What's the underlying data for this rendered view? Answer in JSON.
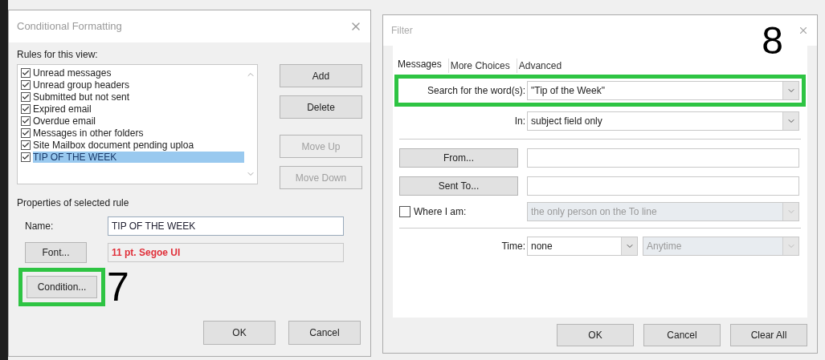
{
  "conditional_formatting": {
    "title": "Conditional Formatting",
    "rules_label": "Rules for this view:",
    "rules": [
      {
        "label": "Unread messages",
        "checked": true,
        "selected": false
      },
      {
        "label": "Unread group headers",
        "checked": true,
        "selected": false
      },
      {
        "label": "Submitted but not sent",
        "checked": true,
        "selected": false
      },
      {
        "label": "Expired email",
        "checked": true,
        "selected": false
      },
      {
        "label": "Overdue email",
        "checked": true,
        "selected": false
      },
      {
        "label": "Messages in other folders",
        "checked": true,
        "selected": false
      },
      {
        "label": "Site Mailbox document pending uploa",
        "checked": true,
        "selected": false
      },
      {
        "label": "TIP OF THE WEEK",
        "checked": true,
        "selected": true
      }
    ],
    "side_buttons": [
      {
        "label": "Add",
        "disabled": false
      },
      {
        "label": "Delete",
        "disabled": false
      },
      {
        "label": "Move Up",
        "disabled": true
      },
      {
        "label": "Move Down",
        "disabled": true
      }
    ],
    "properties_label": "Properties of selected rule",
    "name_label": "Name:",
    "name_value": "TIP OF THE WEEK",
    "font_button": "Font...",
    "font_value": "11 pt. Segoe UI",
    "condition_button": {
      "label": "Condition...",
      "highlighted": true
    },
    "step_number": "7",
    "footer_buttons": [
      "OK",
      "Cancel"
    ]
  },
  "filter": {
    "title": "Filter",
    "step_number": "8",
    "tabs": [
      {
        "label": "Messages",
        "selected": true
      },
      {
        "label": "More Choices",
        "selected": false
      },
      {
        "label": "Advanced",
        "selected": false
      }
    ],
    "search": {
      "label": "Search for the word(s):",
      "value": "\"Tip of the Week\"",
      "highlighted": true
    },
    "in": {
      "label": "In:",
      "value": "subject field only"
    },
    "from_button": "From...",
    "sent_to_button": "Sent To...",
    "where": {
      "label": "Where I am:",
      "checked": false,
      "value": "the only person on the To line"
    },
    "time": {
      "label": "Time:",
      "value": "none",
      "range_value": "Anytime"
    },
    "footer_buttons": [
      "OK",
      "Cancel",
      "Clear All"
    ]
  }
}
